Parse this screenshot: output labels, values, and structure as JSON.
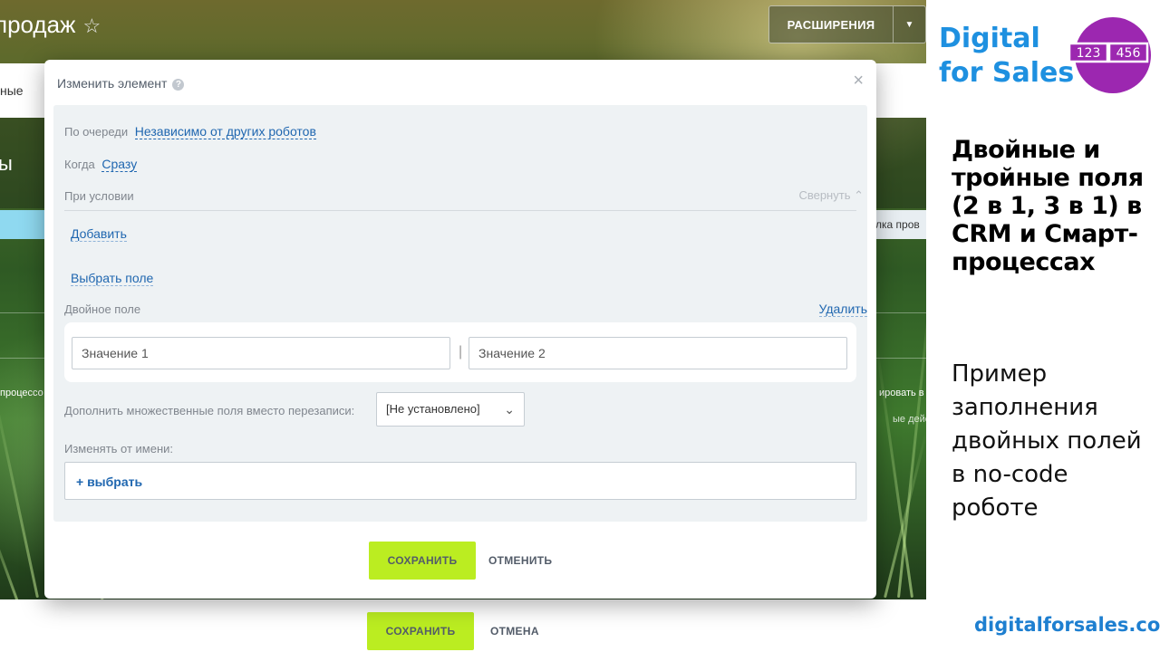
{
  "background": {
    "header_title": "продаж",
    "star_icon": "star-outline-icon",
    "extensions_label": "РАСШИРЕНИЯ",
    "tab_text": "ные",
    "band_text": "ы",
    "right_bar_text": "лка пров",
    "left_text": "процессо",
    "right_text": "ировать в",
    "right_text2": "ые дейс",
    "save_label": "СОХРАНИТЬ",
    "cancel_label": "ОТМЕНА"
  },
  "modal": {
    "title": "Изменить элемент",
    "help_icon": "?",
    "close_icon": "×",
    "queue_label": "По очереди",
    "queue_value": "Независимо от других роботов",
    "when_label": "Когда",
    "when_value": "Сразу",
    "condition_label": "При условии",
    "collapse_label": "Свернуть",
    "add_link": "Добавить",
    "choose_field_link": "Выбрать поле",
    "double_field_label": "Двойное поле",
    "delete_link": "Удалить",
    "value1_placeholder": "Значение 1",
    "value2_placeholder": "Значение 2",
    "separator": "|",
    "multiple_label": "Дополнить множественные поля вместо перезаписи:",
    "multiple_value": "[Не установлено]",
    "change_from_label": "Изменять от имени:",
    "select_user": "+ выбрать",
    "save_label": "СОХРАНИТЬ",
    "cancel_label": "ОТМЕНИТЬ"
  },
  "promo": {
    "brand_line1": "Digital",
    "brand_line2": "for Sales",
    "logo_num1": "123",
    "logo_num2": "456",
    "heading": "Двойные и тройные поля (2 в 1, 3 в 1) в CRM и Смарт-процессах",
    "subheading": "Пример заполнения двойных полей в no-code роботе",
    "url": "digitalforsales.com"
  },
  "colors": {
    "accent_green": "#bbed21",
    "link_blue": "#2067b0",
    "brand_blue": "#1e90e0",
    "logo_purple": "#9c27b0"
  }
}
